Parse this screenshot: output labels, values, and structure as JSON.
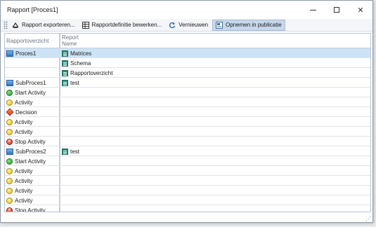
{
  "window": {
    "title": "Rapport [Proces1]"
  },
  "toolbar": {
    "export_label": "Rapport exporteren...",
    "edit_label": "Rapportdefinitie bewerken...",
    "refresh_label": "Vernieuwen",
    "publish_label": "Opnemen in publicatie"
  },
  "grid": {
    "left_header": "Rapportoverzicht",
    "right_header_line1": "Report",
    "right_header_line2": "Name",
    "rows": [
      {
        "left": "Proces1",
        "left_icon": "process-icon",
        "right": "Matrices",
        "right_icon": "report-icon",
        "selected": true
      },
      {
        "left": "",
        "left_icon": "",
        "right": "Schema",
        "right_icon": "report-icon"
      },
      {
        "left": "",
        "left_icon": "",
        "right": "Rapportoverzicht",
        "right_icon": "report-icon"
      },
      {
        "left": "SubProces1",
        "left_icon": "process-icon",
        "right": "test",
        "right_icon": "report-icon"
      },
      {
        "left": "Start Activity",
        "left_icon": "start-icon",
        "right": "",
        "right_icon": ""
      },
      {
        "left": "Activity",
        "left_icon": "activity-icon",
        "right": "",
        "right_icon": ""
      },
      {
        "left": "Decision",
        "left_icon": "decision-icon",
        "right": "",
        "right_icon": ""
      },
      {
        "left": "Activity",
        "left_icon": "activity-icon",
        "right": "",
        "right_icon": ""
      },
      {
        "left": "Activity",
        "left_icon": "activity-icon",
        "right": "",
        "right_icon": ""
      },
      {
        "left": "Stop Activity",
        "left_icon": "stop-icon",
        "right": "",
        "right_icon": ""
      },
      {
        "left": "SubProces2",
        "left_icon": "process-icon",
        "right": "test",
        "right_icon": "report-icon"
      },
      {
        "left": "Start Activity",
        "left_icon": "start-icon",
        "right": "",
        "right_icon": ""
      },
      {
        "left": "Activity",
        "left_icon": "activity-icon",
        "right": "",
        "right_icon": ""
      },
      {
        "left": "Activity",
        "left_icon": "activity-icon",
        "right": "",
        "right_icon": ""
      },
      {
        "left": "Activity",
        "left_icon": "activity-icon",
        "right": "",
        "right_icon": ""
      },
      {
        "left": "Activity",
        "left_icon": "activity-icon",
        "right": "",
        "right_icon": ""
      },
      {
        "left": "Stop Activity",
        "left_icon": "stop-icon",
        "right": "",
        "right_icon": ""
      }
    ]
  },
  "colors": {
    "selection": "#cde3f5",
    "active_button": "#c8d8ea"
  }
}
